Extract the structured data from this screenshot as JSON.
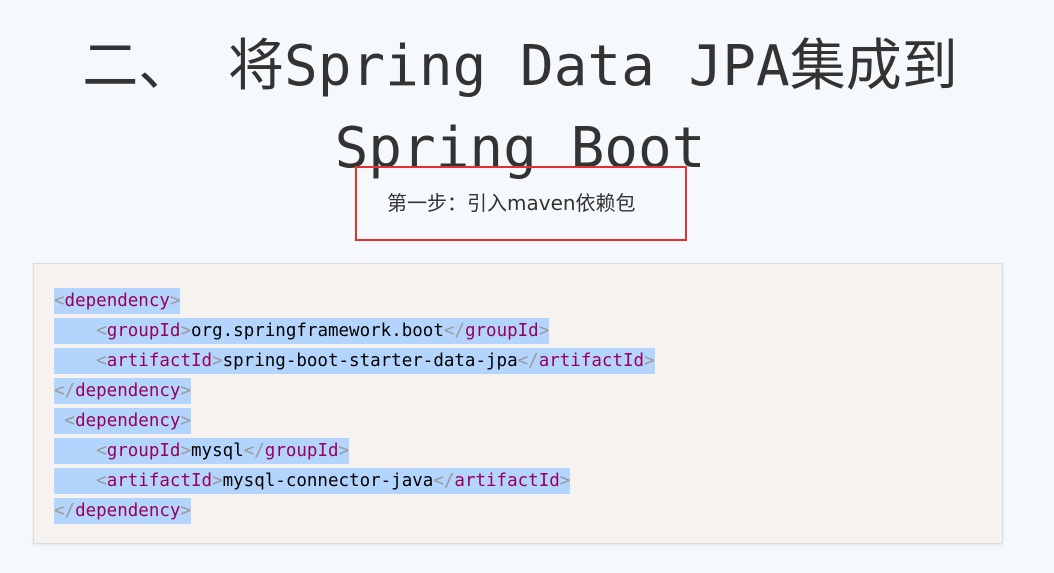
{
  "heading": {
    "line1": "二、 将Spring Data JPA集成到",
    "line2": "Spring Boot"
  },
  "step_label": "第一步：引入maven依赖包",
  "colors": {
    "highlight_box": "#e0332f",
    "tag": "#990055",
    "punctuation": "#999999",
    "selection": "#b3d4fc",
    "code_background": "#f5f2f0"
  },
  "code_lines": [
    {
      "indent": "",
      "tag": "dependency",
      "text": "",
      "close": false
    },
    {
      "indent": "    ",
      "tag": "groupId",
      "text": "org.springframework.boot",
      "close": true
    },
    {
      "indent": "    ",
      "tag": "artifactId",
      "text": "spring-boot-starter-data-jpa",
      "close": true
    },
    {
      "indent": "",
      "tag": "/dependency",
      "text": "",
      "close": false
    },
    {
      "indent": " ",
      "tag": "dependency",
      "text": "",
      "close": false
    },
    {
      "indent": "    ",
      "tag": "groupId",
      "text": "mysql",
      "close": true
    },
    {
      "indent": "    ",
      "tag": "artifactId",
      "text": "mysql-connector-java",
      "close": true
    },
    {
      "indent": "",
      "tag": "/dependency",
      "text": "",
      "close": false
    }
  ]
}
